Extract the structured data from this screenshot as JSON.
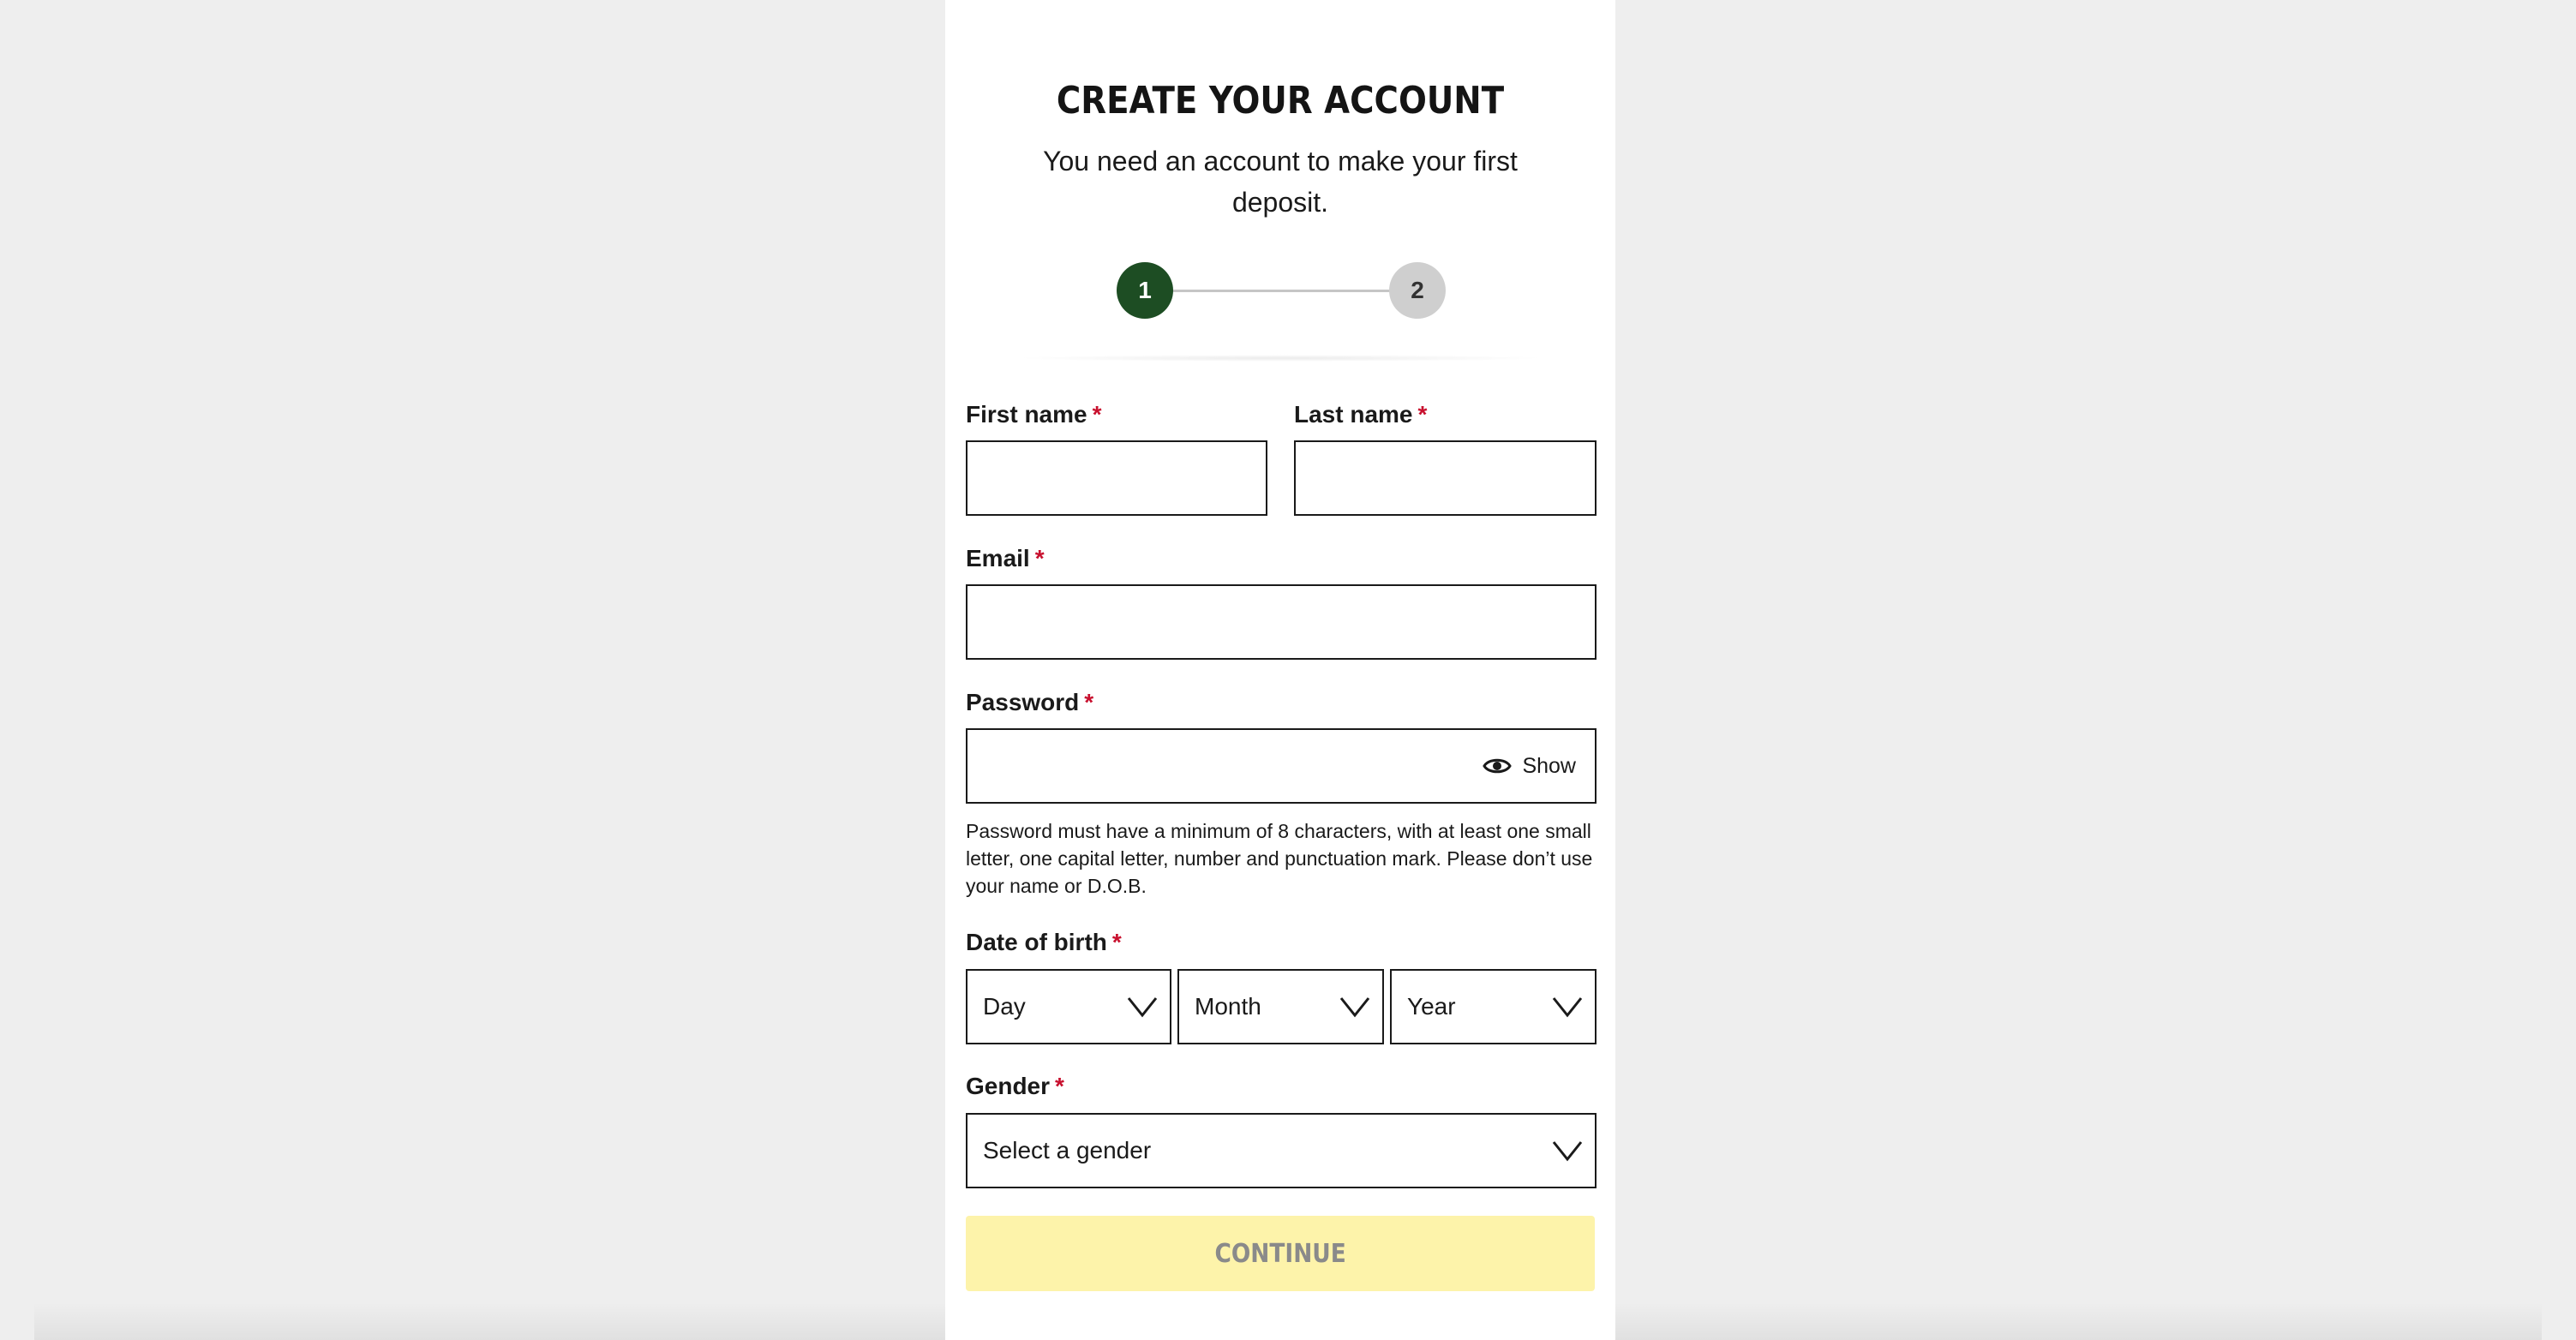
{
  "header": {
    "title": "CREATE YOUR ACCOUNT",
    "subtitle": "You need an account to make your first deposit."
  },
  "stepper": {
    "steps": [
      "1",
      "2"
    ],
    "current_step": 1
  },
  "form": {
    "required_marker": "*",
    "first_name": {
      "label": "First name",
      "value": ""
    },
    "last_name": {
      "label": "Last name",
      "value": ""
    },
    "email": {
      "label": "Email",
      "value": ""
    },
    "password": {
      "label": "Password",
      "value": "",
      "show_label": "Show",
      "hint": "Password must have a minimum of 8 characters, with at least one small letter, one capital letter, number and punctuation mark. Please don’t use your name or D.O.B."
    },
    "date_of_birth": {
      "label": "Date of birth",
      "day": "Day",
      "month": "Month",
      "year": "Year"
    },
    "gender": {
      "label": "Gender",
      "selected": "Select a gender"
    },
    "continue_label": "CONTINUE"
  },
  "colors": {
    "step_active": "#1d4d23",
    "step_inactive": "#cfcfcf",
    "required": "#c8102e",
    "continue_disabled_bg": "#fdf3aa",
    "continue_disabled_text": "#8a8a8a"
  },
  "icons": {
    "show_password": "eye-icon",
    "dropdown": "chevron-down-icon"
  }
}
